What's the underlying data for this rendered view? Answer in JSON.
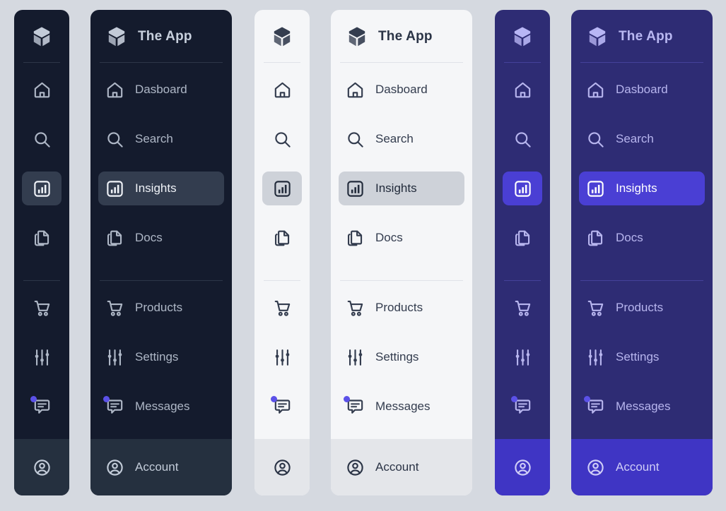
{
  "app": {
    "brand_label": "The App",
    "logo_icon": "cube-icon"
  },
  "nav": {
    "items": [
      {
        "label": "Dasboard",
        "icon": "home-icon",
        "active": false,
        "badge": false
      },
      {
        "label": "Search",
        "icon": "search-icon",
        "active": false,
        "badge": false
      },
      {
        "label": "Insights",
        "icon": "bar-chart-icon",
        "active": true,
        "badge": false
      },
      {
        "label": "Docs",
        "icon": "copy-icon",
        "active": false,
        "badge": false
      },
      {
        "label": "Products",
        "icon": "cart-icon",
        "active": false,
        "badge": false
      },
      {
        "label": "Settings",
        "icon": "sliders-icon",
        "active": false,
        "badge": false
      },
      {
        "label": "Messages",
        "icon": "message-icon",
        "active": false,
        "badge": true
      }
    ]
  },
  "footer": {
    "label": "Account",
    "icon": "user-circle-icon"
  },
  "badge_color": "#5b51e8",
  "variants": [
    {
      "id": "p1",
      "theme": "dark",
      "mode": "rail",
      "label": "dark-collapsed-sidebar"
    },
    {
      "id": "p2",
      "theme": "dark",
      "mode": "full",
      "label": "dark-expanded-sidebar"
    },
    {
      "id": "p3",
      "theme": "light",
      "mode": "rail",
      "label": "light-collapsed-sidebar"
    },
    {
      "id": "p4",
      "theme": "light",
      "mode": "full",
      "label": "light-expanded-sidebar"
    },
    {
      "id": "p5",
      "theme": "indigo",
      "mode": "rail",
      "label": "indigo-collapsed-sidebar"
    },
    {
      "id": "p6",
      "theme": "indigo",
      "mode": "full",
      "label": "indigo-expanded-sidebar"
    }
  ],
  "page": {
    "background": "#d5d9e0"
  }
}
